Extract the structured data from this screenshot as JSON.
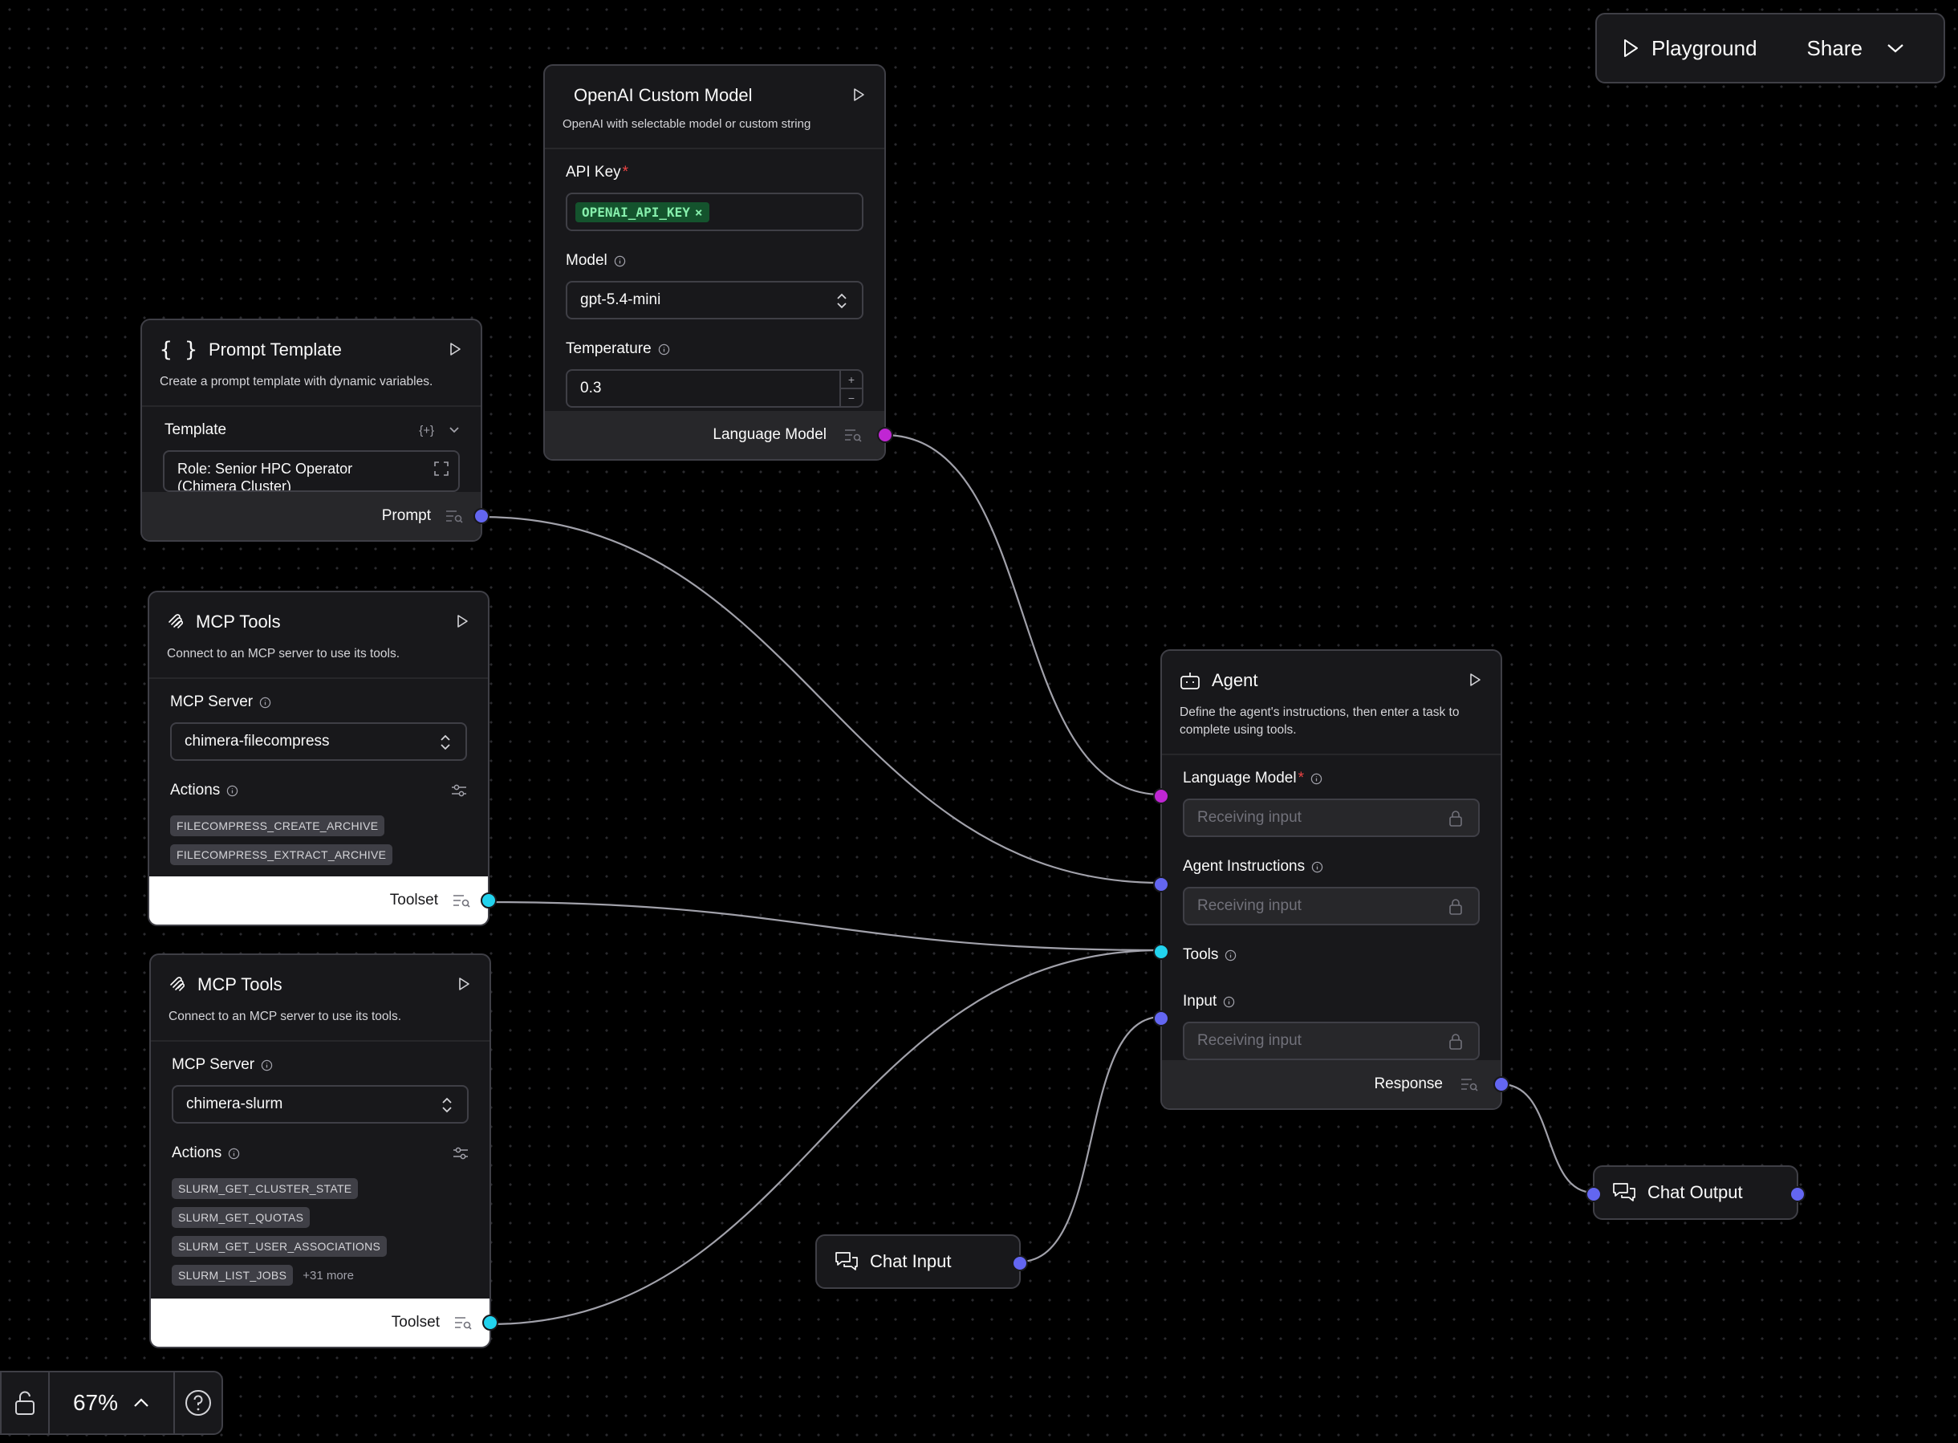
{
  "topbar": {
    "playground_label": "Playground",
    "share_label": "Share"
  },
  "zoom": {
    "level": "67%"
  },
  "nodes": {
    "openai": {
      "title": "OpenAI Custom Model",
      "description": "OpenAI with selectable model or custom string",
      "api_key_label": "API Key",
      "api_key_value": "OPENAI_API_KEY",
      "model_label": "Model",
      "model_value": "gpt-5.4-mini",
      "temperature_label": "Temperature",
      "temperature_value": "0.3",
      "output_label": "Language Model"
    },
    "prompt": {
      "title": "Prompt Template",
      "description": "Create a prompt template with dynamic variables.",
      "template_label": "Template",
      "template_value": "Role: Senior HPC Operator\n(Chimera Cluster)",
      "output_label": "Prompt"
    },
    "mcp1": {
      "title": "MCP Tools",
      "description": "Connect to an MCP server to use its tools.",
      "server_label": "MCP Server",
      "server_value": "chimera-filecompress",
      "actions_label": "Actions",
      "actions": [
        "FILECOMPRESS_CREATE_ARCHIVE",
        "FILECOMPRESS_EXTRACT_ARCHIVE"
      ],
      "output_label": "Toolset"
    },
    "mcp2": {
      "title": "MCP Tools",
      "description": "Connect to an MCP server to use its tools.",
      "server_label": "MCP Server",
      "server_value": "chimera-slurm",
      "actions_label": "Actions",
      "actions": [
        "SLURM_GET_CLUSTER_STATE",
        "SLURM_GET_QUOTAS",
        "SLURM_GET_USER_ASSOCIATIONS",
        "SLURM_LIST_JOBS"
      ],
      "more_label": "+31 more",
      "output_label": "Toolset"
    },
    "agent": {
      "title": "Agent",
      "description": "Define the agent's instructions, then enter a task to complete using tools.",
      "language_model_label": "Language Model",
      "instructions_label": "Agent Instructions",
      "tools_label": "Tools",
      "input_label": "Input",
      "receiving_placeholder": "Receiving input",
      "output_label": "Response"
    },
    "chat_input": {
      "title": "Chat Input"
    },
    "chat_output": {
      "title": "Chat Output"
    }
  },
  "colors": {
    "pink_handle": "#c026d3",
    "indigo_handle": "#6366f1",
    "cyan_handle": "#22d3ee",
    "edge": "#a1a1aa"
  }
}
